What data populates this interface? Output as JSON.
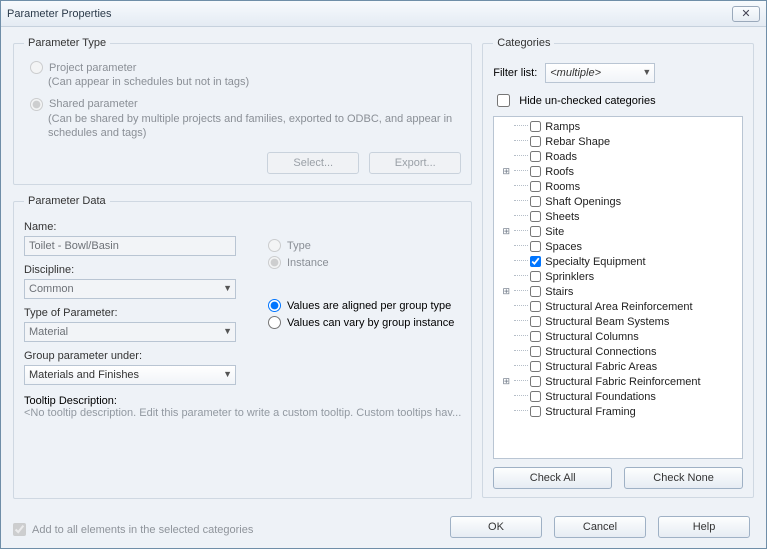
{
  "window": {
    "title": "Parameter Properties"
  },
  "param_type": {
    "legend": "Parameter Type",
    "project": {
      "label": "Project parameter",
      "desc": "(Can appear in schedules but not in tags)"
    },
    "shared": {
      "label": "Shared parameter",
      "desc": "(Can be shared by multiple projects and families, exported to ODBC, and appear in schedules and tags)"
    },
    "select_btn": "Select...",
    "export_btn": "Export..."
  },
  "param_data": {
    "legend": "Parameter Data",
    "name_label": "Name:",
    "name_value": "Toilet - Bowl/Basin",
    "discipline_label": "Discipline:",
    "discipline_value": "Common",
    "type_of_param_label": "Type of Parameter:",
    "type_of_param_value": "Material",
    "group_label": "Group parameter under:",
    "group_value": "Materials and Finishes",
    "type_radio": "Type",
    "instance_radio": "Instance",
    "align_group_radio": "Values are aligned per group type",
    "vary_group_radio": "Values can vary by group instance",
    "tooltip_label": "Tooltip Description:",
    "tooltip_placeholder": "<No tooltip description. Edit this parameter to write a custom tooltip. Custom tooltips hav..."
  },
  "add_all": {
    "label": "Add to all elements in the selected categories",
    "checked": true
  },
  "categories": {
    "legend": "Categories",
    "filter_label": "Filter list:",
    "filter_value": "<multiple>",
    "hide_unchecked": {
      "label": "Hide un-checked categories",
      "checked": false
    },
    "items": [
      {
        "label": "Ramps",
        "checked": false,
        "expander": ""
      },
      {
        "label": "Rebar Shape",
        "checked": false,
        "expander": ""
      },
      {
        "label": "Roads",
        "checked": false,
        "expander": ""
      },
      {
        "label": "Roofs",
        "checked": false,
        "expander": "+"
      },
      {
        "label": "Rooms",
        "checked": false,
        "expander": ""
      },
      {
        "label": "Shaft Openings",
        "checked": false,
        "expander": ""
      },
      {
        "label": "Sheets",
        "checked": false,
        "expander": ""
      },
      {
        "label": "Site",
        "checked": false,
        "expander": "+"
      },
      {
        "label": "Spaces",
        "checked": false,
        "expander": ""
      },
      {
        "label": "Specialty Equipment",
        "checked": true,
        "expander": ""
      },
      {
        "label": "Sprinklers",
        "checked": false,
        "expander": ""
      },
      {
        "label": "Stairs",
        "checked": false,
        "expander": "+"
      },
      {
        "label": "Structural Area Reinforcement",
        "checked": false,
        "expander": ""
      },
      {
        "label": "Structural Beam Systems",
        "checked": false,
        "expander": ""
      },
      {
        "label": "Structural Columns",
        "checked": false,
        "expander": ""
      },
      {
        "label": "Structural Connections",
        "checked": false,
        "expander": ""
      },
      {
        "label": "Structural Fabric Areas",
        "checked": false,
        "expander": ""
      },
      {
        "label": "Structural Fabric Reinforcement",
        "checked": false,
        "expander": "+"
      },
      {
        "label": "Structural Foundations",
        "checked": false,
        "expander": ""
      },
      {
        "label": "Structural Framing",
        "checked": false,
        "expander": ""
      }
    ],
    "check_all": "Check All",
    "check_none": "Check None"
  },
  "buttons": {
    "ok": "OK",
    "cancel": "Cancel",
    "help": "Help"
  }
}
